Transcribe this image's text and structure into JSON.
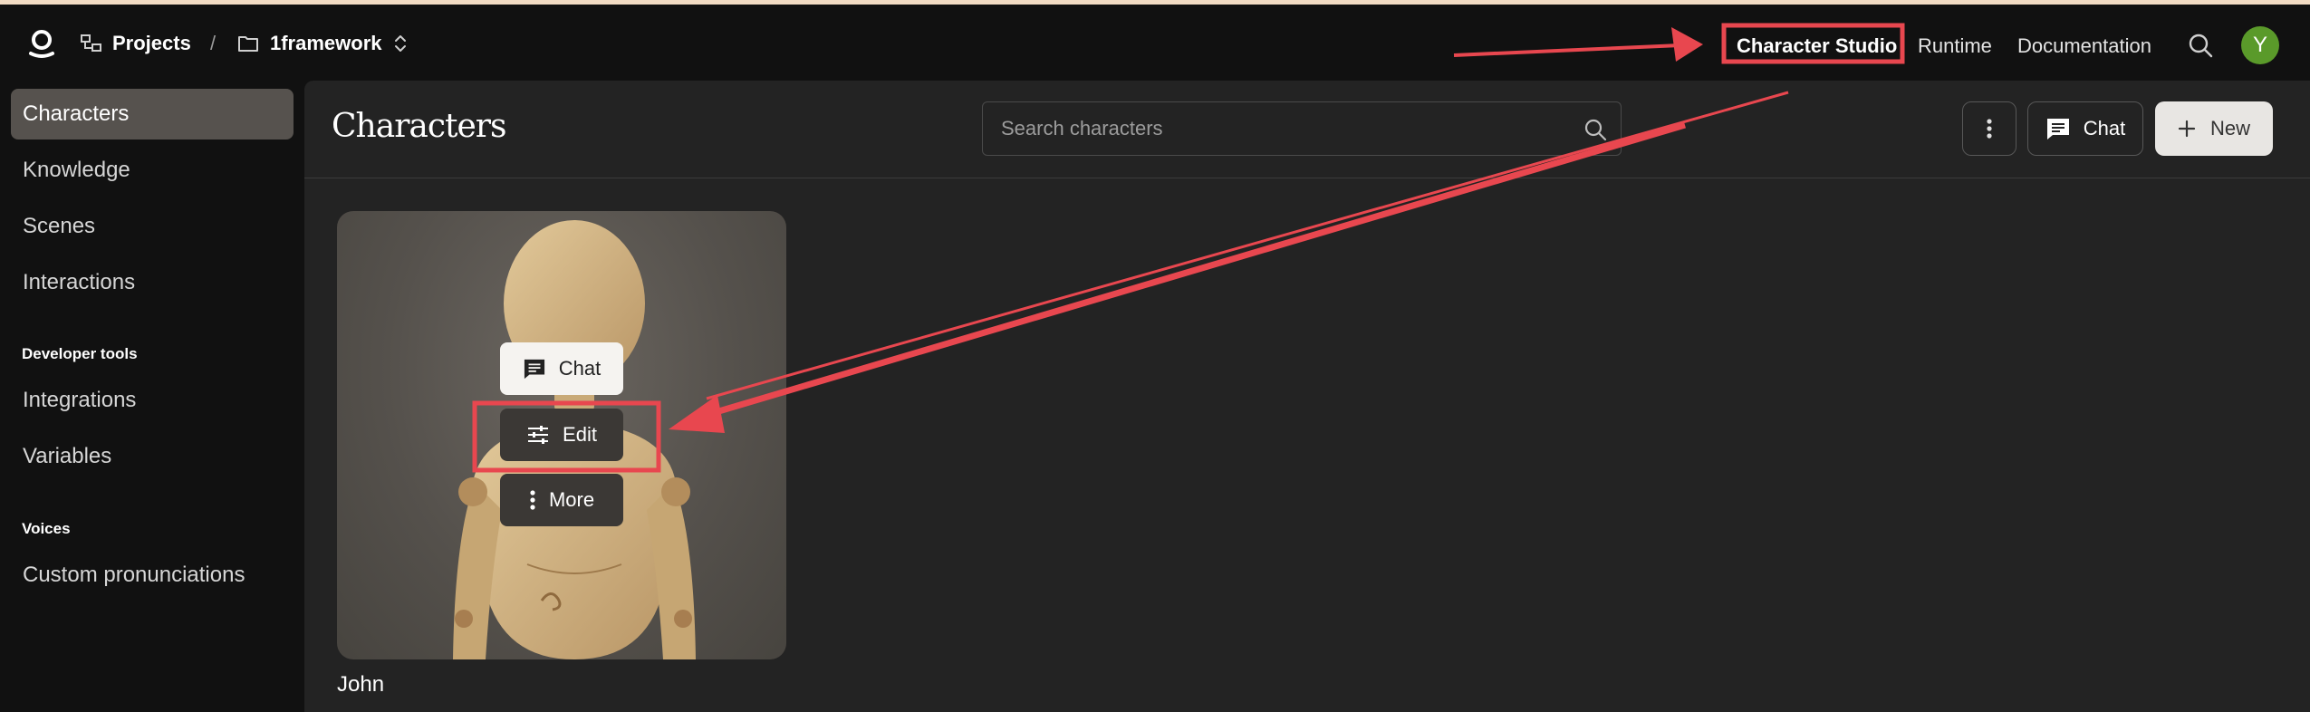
{
  "header": {
    "projects_label": "Projects",
    "separator": "/",
    "project_name": "1framework",
    "nav": {
      "active": "Character Studio",
      "runtime": "Runtime",
      "documentation": "Documentation"
    },
    "avatar_initial": "Y"
  },
  "sidebar": {
    "items": [
      {
        "label": "Characters",
        "active": true
      },
      {
        "label": "Knowledge"
      },
      {
        "label": "Scenes"
      },
      {
        "label": "Interactions"
      }
    ],
    "sections": [
      {
        "title": "Developer tools",
        "items": [
          "Integrations",
          "Variables"
        ]
      },
      {
        "title": "Voices",
        "items": [
          "Custom pronunciations"
        ]
      }
    ]
  },
  "main": {
    "title": "Characters",
    "search": {
      "placeholder": "Search characters",
      "value": ""
    },
    "actions": {
      "chat": "Chat",
      "new": "New"
    },
    "characters": [
      {
        "name": "John",
        "actions": {
          "chat": "Chat",
          "edit": "Edit",
          "more": "More"
        }
      }
    ]
  },
  "colors": {
    "background": "#111111",
    "panel": "#232323",
    "sidebar_active": "#56524e",
    "avatar": "#5a9a2a",
    "annotation": "#e8474f"
  },
  "icons": [
    "logo-icon",
    "projects-icon",
    "folder-icon",
    "chevron-updown-icon",
    "search-icon",
    "kebab-icon",
    "chat-icon",
    "plus-icon",
    "sliders-icon"
  ]
}
